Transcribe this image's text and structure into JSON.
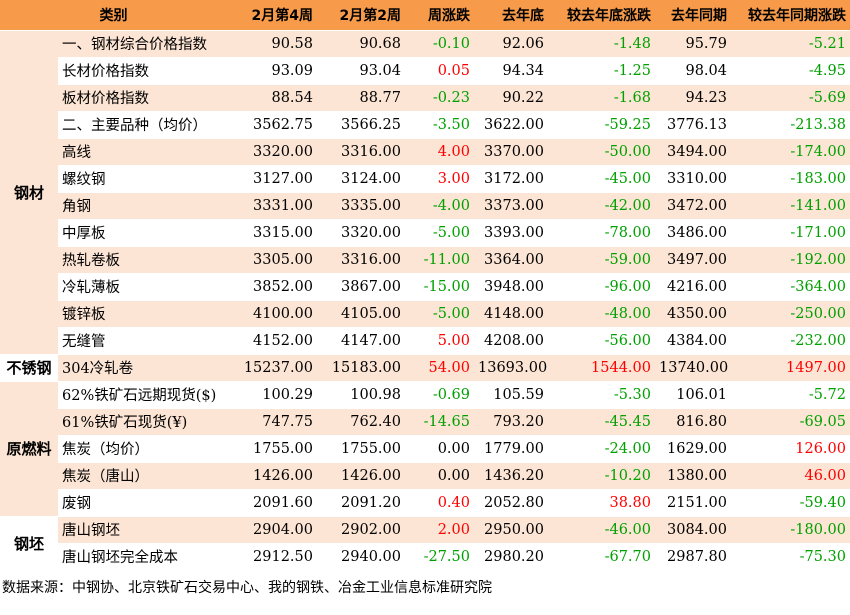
{
  "headers": [
    "类别",
    "2月第4周",
    "2月第2周",
    "周涨跌",
    "去年底",
    "较去年底涨跌",
    "去年同期",
    "较去年同期涨跌"
  ],
  "groups": [
    {
      "category": "钢材",
      "bg": "peach",
      "rows": [
        {
          "name": "一、钢材综合价格指数",
          "bg": "peach",
          "v1": "90.58",
          "v2": "90.68",
          "wk": "-0.10",
          "wk_c": "green",
          "ly": "92.06",
          "lyd": "-1.48",
          "lyd_c": "green",
          "yoy": "95.79",
          "yoyd": "-5.21",
          "yoyd_c": "green"
        },
        {
          "name": "长材价格指数",
          "bg": "white",
          "v1": "93.09",
          "v2": "93.04",
          "wk": "0.05",
          "wk_c": "red",
          "ly": "94.34",
          "lyd": "-1.25",
          "lyd_c": "green",
          "yoy": "98.04",
          "yoyd": "-4.95",
          "yoyd_c": "green"
        },
        {
          "name": "板材价格指数",
          "bg": "peach",
          "v1": "88.54",
          "v2": "88.77",
          "wk": "-0.23",
          "wk_c": "green",
          "ly": "90.22",
          "lyd": "-1.68",
          "lyd_c": "green",
          "yoy": "94.23",
          "yoyd": "-5.69",
          "yoyd_c": "green"
        },
        {
          "name": "二、主要品种（均价）",
          "bg": "white",
          "v1": "3562.75",
          "v2": "3566.25",
          "wk": "-3.50",
          "wk_c": "green",
          "ly": "3622.00",
          "lyd": "-59.25",
          "lyd_c": "green",
          "yoy": "3776.13",
          "yoyd": "-213.38",
          "yoyd_c": "green"
        },
        {
          "name": "高线",
          "bg": "peach",
          "v1": "3320.00",
          "v2": "3316.00",
          "wk": "4.00",
          "wk_c": "red",
          "ly": "3370.00",
          "lyd": "-50.00",
          "lyd_c": "green",
          "yoy": "3494.00",
          "yoyd": "-174.00",
          "yoyd_c": "green"
        },
        {
          "name": "螺纹钢",
          "bg": "white",
          "v1": "3127.00",
          "v2": "3124.00",
          "wk": "3.00",
          "wk_c": "red",
          "ly": "3172.00",
          "lyd": "-45.00",
          "lyd_c": "green",
          "yoy": "3310.00",
          "yoyd": "-183.00",
          "yoyd_c": "green"
        },
        {
          "name": "角钢",
          "bg": "peach",
          "v1": "3331.00",
          "v2": "3335.00",
          "wk": "-4.00",
          "wk_c": "green",
          "ly": "3373.00",
          "lyd": "-42.00",
          "lyd_c": "green",
          "yoy": "3472.00",
          "yoyd": "-141.00",
          "yoyd_c": "green"
        },
        {
          "name": "中厚板",
          "bg": "white",
          "v1": "3315.00",
          "v2": "3320.00",
          "wk": "-5.00",
          "wk_c": "green",
          "ly": "3393.00",
          "lyd": "-78.00",
          "lyd_c": "green",
          "yoy": "3486.00",
          "yoyd": "-171.00",
          "yoyd_c": "green"
        },
        {
          "name": "热轧卷板",
          "bg": "peach",
          "v1": "3305.00",
          "v2": "3316.00",
          "wk": "-11.00",
          "wk_c": "green",
          "ly": "3364.00",
          "lyd": "-59.00",
          "lyd_c": "green",
          "yoy": "3497.00",
          "yoyd": "-192.00",
          "yoyd_c": "green"
        },
        {
          "name": "冷轧薄板",
          "bg": "white",
          "v1": "3852.00",
          "v2": "3867.00",
          "wk": "-15.00",
          "wk_c": "green",
          "ly": "3948.00",
          "lyd": "-96.00",
          "lyd_c": "green",
          "yoy": "4216.00",
          "yoyd": "-364.00",
          "yoyd_c": "green"
        },
        {
          "name": "镀锌板",
          "bg": "peach",
          "v1": "4100.00",
          "v2": "4105.00",
          "wk": "-5.00",
          "wk_c": "green",
          "ly": "4148.00",
          "lyd": "-48.00",
          "lyd_c": "green",
          "yoy": "4350.00",
          "yoyd": "-250.00",
          "yoyd_c": "green"
        },
        {
          "name": "无缝管",
          "bg": "white",
          "v1": "4152.00",
          "v2": "4147.00",
          "wk": "5.00",
          "wk_c": "red",
          "ly": "4208.00",
          "lyd": "-56.00",
          "lyd_c": "green",
          "yoy": "4384.00",
          "yoyd": "-232.00",
          "yoyd_c": "green"
        }
      ]
    },
    {
      "category": "不锈钢",
      "bg": "white",
      "rows": [
        {
          "name": "304冷轧卷",
          "bg": "peach",
          "v1": "15237.00",
          "v2": "15183.00",
          "wk": "54.00",
          "wk_c": "red",
          "ly": "13693.00",
          "lyd": "1544.00",
          "lyd_c": "red",
          "yoy": "13740.00",
          "yoyd": "1497.00",
          "yoyd_c": "red"
        }
      ]
    },
    {
      "category": "原燃料",
      "bg": "peach",
      "rows": [
        {
          "name": "62%铁矿石远期现货($)",
          "bg": "white",
          "v1": "100.29",
          "v2": "100.98",
          "wk": "-0.69",
          "wk_c": "green",
          "ly": "105.59",
          "lyd": "-5.30",
          "lyd_c": "green",
          "yoy": "106.01",
          "yoyd": "-5.72",
          "yoyd_c": "green"
        },
        {
          "name": "61%铁矿石现货(¥)",
          "bg": "peach",
          "v1": "747.75",
          "v2": "762.40",
          "wk": "-14.65",
          "wk_c": "green",
          "ly": "793.20",
          "lyd": "-45.45",
          "lyd_c": "green",
          "yoy": "816.80",
          "yoyd": "-69.05",
          "yoyd_c": "green"
        },
        {
          "name": "焦炭（均价）",
          "bg": "white",
          "v1": "1755.00",
          "v2": "1755.00",
          "wk": "0.00",
          "wk_c": "black",
          "ly": "1779.00",
          "lyd": "-24.00",
          "lyd_c": "green",
          "yoy": "1629.00",
          "yoyd": "126.00",
          "yoyd_c": "red"
        },
        {
          "name": "焦炭（唐山）",
          "bg": "peach",
          "v1": "1426.00",
          "v2": "1426.00",
          "wk": "0.00",
          "wk_c": "black",
          "ly": "1436.20",
          "lyd": "-10.20",
          "lyd_c": "green",
          "yoy": "1380.00",
          "yoyd": "46.00",
          "yoyd_c": "red"
        },
        {
          "name": "废钢",
          "bg": "white",
          "v1": "2091.60",
          "v2": "2091.20",
          "wk": "0.40",
          "wk_c": "red",
          "ly": "2052.80",
          "lyd": "38.80",
          "lyd_c": "red",
          "yoy": "2151.00",
          "yoyd": "-59.40",
          "yoyd_c": "green"
        }
      ]
    },
    {
      "category": "钢坯",
      "bg": "white",
      "rows": [
        {
          "name": "唐山钢坯",
          "bg": "peach",
          "v1": "2904.00",
          "v2": "2902.00",
          "wk": "2.00",
          "wk_c": "red",
          "ly": "2950.00",
          "lyd": "-46.00",
          "lyd_c": "green",
          "yoy": "3084.00",
          "yoyd": "-180.00",
          "yoyd_c": "green"
        },
        {
          "name": "唐山钢坯完全成本",
          "bg": "white",
          "v1": "2912.50",
          "v2": "2940.00",
          "wk": "-27.50",
          "wk_c": "green",
          "ly": "2980.20",
          "lyd": "-67.70",
          "lyd_c": "green",
          "yoy": "2987.80",
          "yoyd": "-75.30",
          "yoyd_c": "green"
        }
      ]
    }
  ],
  "source": "数据来源：中钢协、北京铁矿石交易中心、我的钢铁、冶金工业信息标准研究院",
  "colors": {
    "header": "#f79b4b",
    "peach": "#fce5d4",
    "red": "#ff0000",
    "green": "#00a000"
  }
}
